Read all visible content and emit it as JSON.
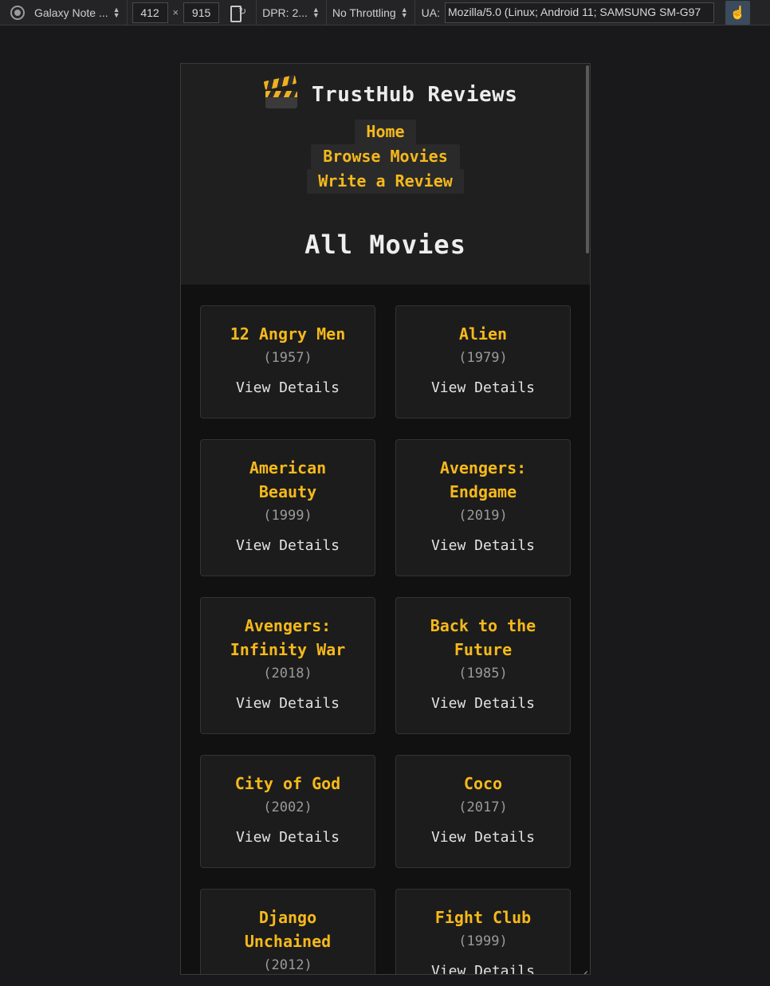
{
  "devtools": {
    "device": "Galaxy Note ...",
    "width": "412",
    "height": "915",
    "dpr": "DPR: 2...",
    "throttling": "No Throttling",
    "ua_label": "UA:",
    "ua_value": "Mozilla/5.0 (Linux; Android 11; SAMSUNG SM-G97"
  },
  "site": {
    "brand": "TrustHub Reviews",
    "nav": [
      "Home",
      "Browse Movies",
      "Write a Review"
    ],
    "page_title": "All Movies",
    "details_label": "View Details"
  },
  "movies": [
    {
      "title": "12 Angry Men",
      "year": "(1957)"
    },
    {
      "title": "Alien",
      "year": "(1979)"
    },
    {
      "title": "American Beauty",
      "year": "(1999)"
    },
    {
      "title": "Avengers: Endgame",
      "year": "(2019)"
    },
    {
      "title": "Avengers: Infinity War",
      "year": "(2018)"
    },
    {
      "title": "Back to the Future",
      "year": "(1985)"
    },
    {
      "title": "City of God",
      "year": "(2002)"
    },
    {
      "title": "Coco",
      "year": "(2017)"
    },
    {
      "title": "Django Unchained",
      "year": "(2012)"
    },
    {
      "title": "Fight Club",
      "year": "(1999)"
    }
  ]
}
